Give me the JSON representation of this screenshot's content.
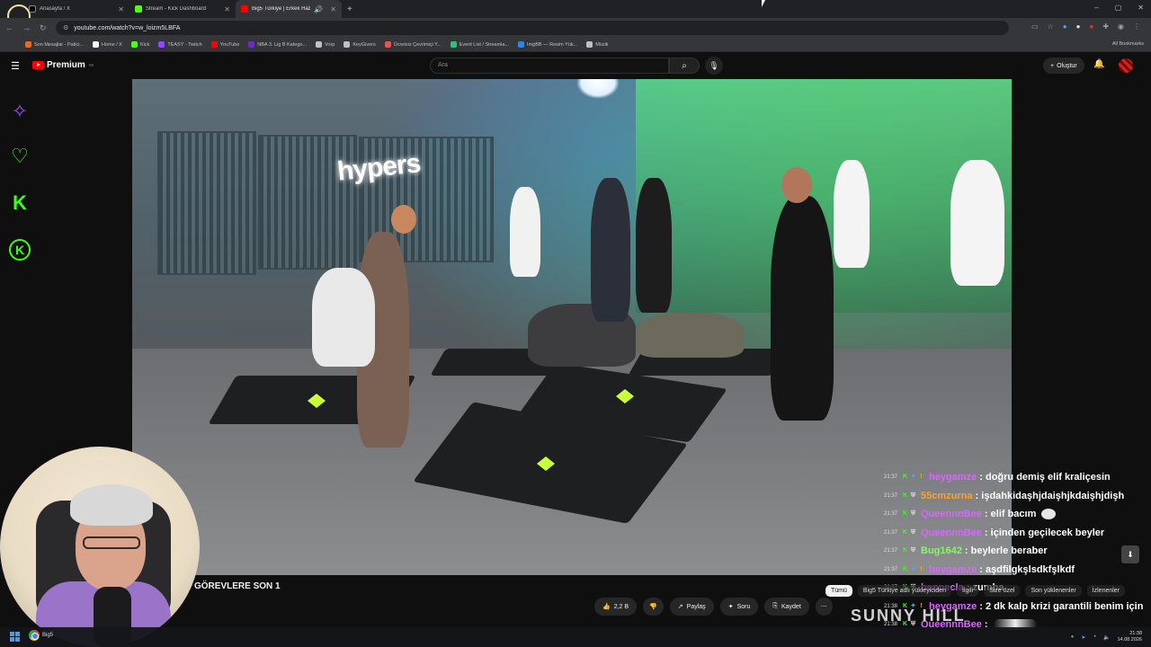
{
  "browser": {
    "tabs": [
      {
        "title": "Anasayfa / X",
        "color": "#ffffff"
      },
      {
        "title": "Stream - Kick Dashboard",
        "color": "#53fc18"
      },
      {
        "title": "Big5 Türkiye | Erkek Hazırlı...",
        "color": "#ff0000",
        "active": true
      }
    ],
    "url": "youtube.com/watch?v=w_loizm5LBFA",
    "bookmarks": [
      {
        "label": "Son Mesajlar - Patici...",
        "color": "#e06c2c"
      },
      {
        "label": "Home / X",
        "color": "#ffffff"
      },
      {
        "label": "Kick",
        "color": "#53fc18"
      },
      {
        "label": "TEASY - Twitch",
        "color": "#9146ff"
      },
      {
        "label": "YouTube",
        "color": "#ff0000"
      },
      {
        "label": "NBA 3. Lig B Katego...",
        "color": "#6f2dbd"
      },
      {
        "label": "Vorp",
        "color": "#bdc1c6"
      },
      {
        "label": "KeyGivers",
        "color": "#bdc1c6"
      },
      {
        "label": "Ücretsiz Çevrimiçi Y...",
        "color": "#e05555"
      },
      {
        "label": "Event List / Streamla...",
        "color": "#2ec27e"
      },
      {
        "label": "ImgBB — Resim Yük...",
        "color": "#3584e4"
      },
      {
        "label": "Müzik",
        "color": "#bdc1c6"
      }
    ],
    "all_bookmarks": "All Bookmarks"
  },
  "youtube": {
    "logo_text": "Premium",
    "logo_sup": "TR",
    "search_placeholder": "Ara",
    "create_label": "Oluştur",
    "video_caption": "GÖREVLERE SON 1",
    "studio_sign": "hypers",
    "actions": {
      "likes": "2,2 B",
      "share": "Paylaş",
      "ask": "Soru",
      "save": "Kaydet"
    }
  },
  "chat": {
    "messages": [
      {
        "time": "21:37",
        "user": "heygamze",
        "color": "#d966ff",
        "text": "doğru demiş elif kraliçesin",
        "badges": [
          "k",
          "mix",
          "gift"
        ]
      },
      {
        "time": "21:37",
        "user": "55cmzurna",
        "color": "#ff9f2b",
        "text": "işdahkidaşhjdaişhjkdaişhjdişh",
        "badges": [
          "k",
          "mod"
        ]
      },
      {
        "time": "21:37",
        "user": "QueennnBee",
        "color": "#d966ff",
        "text": "elif bacım",
        "badges": [
          "k",
          "mod"
        ],
        "emote": true
      },
      {
        "time": "21:37",
        "user": "QueennnBee",
        "color": "#d966ff",
        "text": "içinden geçilecek beyler",
        "badges": [
          "k",
          "mod"
        ]
      },
      {
        "time": "21:37",
        "user": "Bug1642",
        "color": "#7cff5a",
        "text": "beylerle beraber",
        "badges": [
          "k",
          "mod"
        ]
      },
      {
        "time": "21:37",
        "user": "heygamze",
        "color": "#d966ff",
        "text": "aşdfilgkşlsdkfşlkdf",
        "badges": [
          "k",
          "mix",
          "gift"
        ]
      },
      {
        "time": "21:37",
        "user": "bennecla",
        "color": "#d966ff",
        "text": "zumba",
        "badges": [
          "k",
          "mod"
        ]
      },
      {
        "time": "21:38",
        "user": "heygamze",
        "color": "#d966ff",
        "text": "2 dk kalp krizi garantili benim için",
        "badges": [
          "k",
          "mix",
          "gift"
        ]
      },
      {
        "time": "21:38",
        "user": "QueennnBee",
        "color": "#d966ff",
        "text": "",
        "badges": [
          "k",
          "mod"
        ],
        "emote2": true
      }
    ],
    "filters": [
      "Tümü",
      "Big5 Türkiye adlı yükleyiciden",
      "İlgili",
      "Size özel",
      "Son yüklenenler",
      "İzlenenler"
    ],
    "overlay_text": "SUNNY HILL"
  },
  "taskbar": {
    "app_label": "Big5",
    "time": "21:38",
    "date": "14.08.2026"
  }
}
